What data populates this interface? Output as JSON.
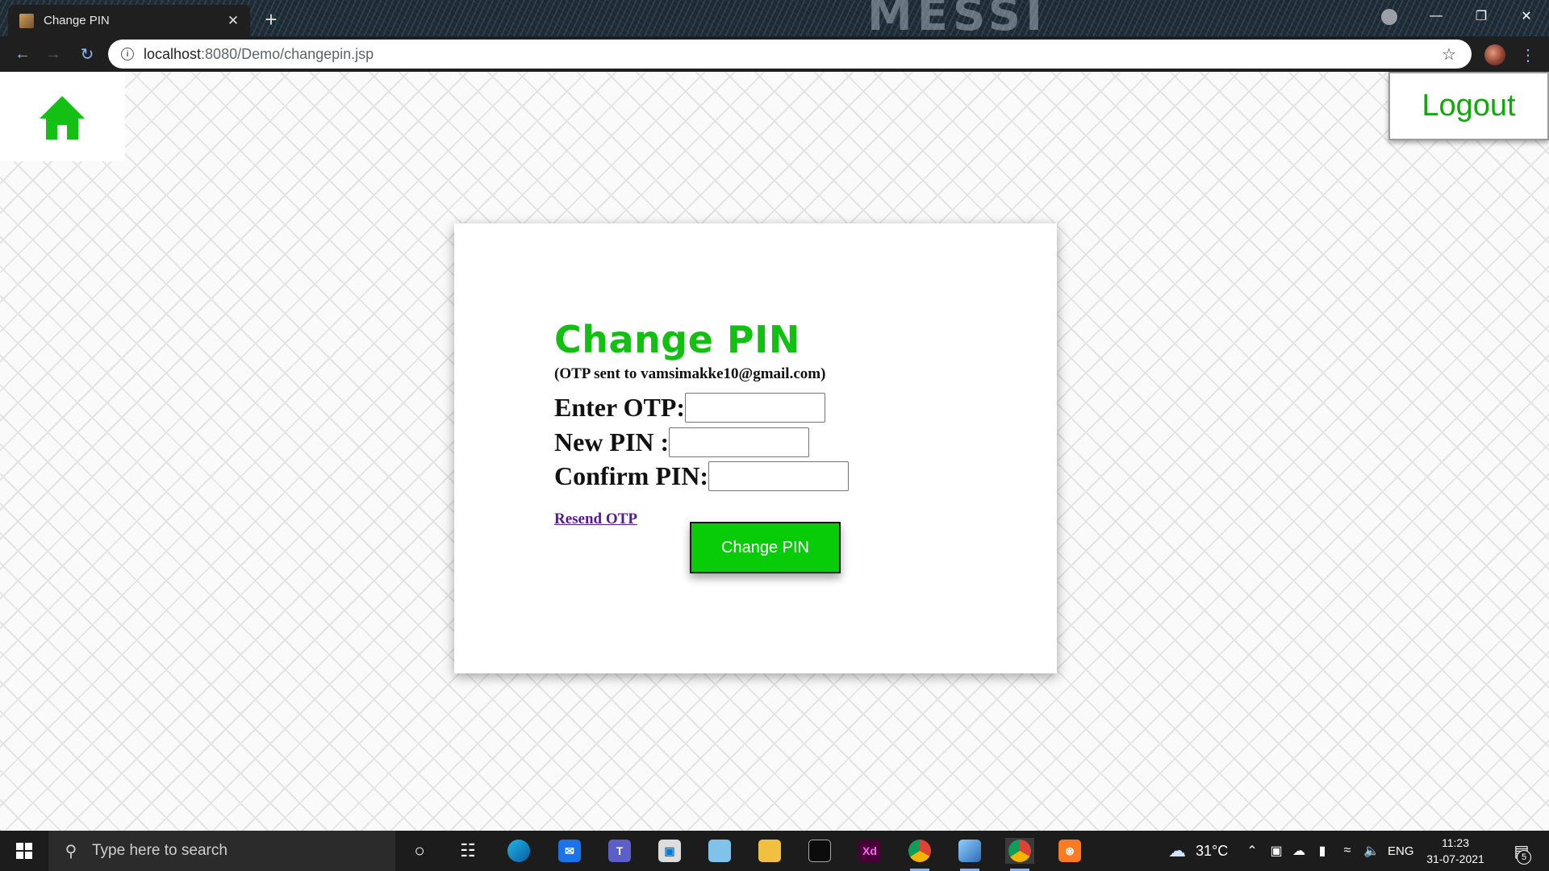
{
  "browser": {
    "tab_title": "Change PIN",
    "tab_close": "✕",
    "new_tab": "+",
    "url_host": "localhost",
    "url_path": ":8080/Demo/changepin.jsp",
    "window_brand": "MESSI"
  },
  "page": {
    "logout_label": "Logout",
    "title": "Change PIN",
    "otp_note": "(OTP sent to vamsimakke10@gmail.com)",
    "fields": {
      "otp_label": "Enter OTP:",
      "otp_value": "",
      "new_pin_label": "New PIN :",
      "new_pin_value": "",
      "confirm_pin_label": "Confirm PIN:",
      "confirm_pin_value": ""
    },
    "resend_label": "Resend OTP",
    "submit_label": "Change PIN",
    "accent_color": "#07cc07",
    "home_icon": "home-icon"
  },
  "taskbar": {
    "search_placeholder": "Type here to search",
    "temperature": "31°C",
    "language": "ENG",
    "time": "11:23",
    "date": "31-07-2021",
    "notification_count": "5",
    "apps": [
      "cortana-icon",
      "task-view-icon",
      "edge-icon",
      "mail-icon",
      "teams-icon",
      "store-icon",
      "notepad-icon",
      "file-explorer-icon",
      "terminal-icon",
      "adobe-xd-icon",
      "chrome-icon",
      "virtualbox-icon",
      "chrome-profile-icon",
      "xampp-icon"
    ]
  }
}
